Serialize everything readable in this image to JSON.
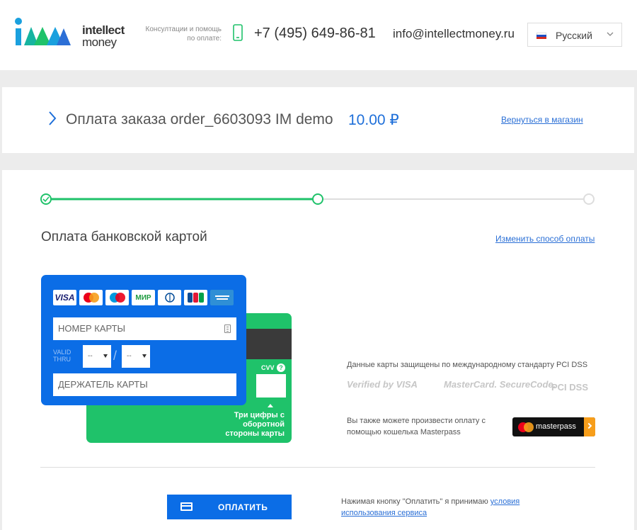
{
  "header": {
    "logo": {
      "line1": "intellect",
      "line2": "money"
    },
    "consult_text": "Консултации и помощь по оплате:",
    "phone": "+7 (495) 649-86-81",
    "email": "info@intellectmoney.ru",
    "language": "Русский"
  },
  "order": {
    "title": "Оплата заказа order_6603093 IM demo",
    "amount": "10.00 ₽",
    "back_link": "Вернуться в магазин"
  },
  "payment": {
    "progress": {
      "steps": 3,
      "completed_steps": 1,
      "current_step": 2
    },
    "section_title": "Оплата банковской картой",
    "change_link": "Изменить способ оплаты",
    "brands": [
      "VISA",
      "mastercard",
      "maestro",
      "МИР",
      "Diners Club",
      "JCB",
      "AMERICAN EXPRESS"
    ],
    "card_number_placeholder": "НОМЕР КАРТЫ",
    "valid_thru_line1": "VALID",
    "valid_thru_line2": "THRU",
    "month_value": "--",
    "year_value": "--",
    "slash": "/",
    "holder_placeholder": "ДЕРЖАТЕЛЬ КАРТЫ",
    "cvv_label": "CVV",
    "cvv_help": "?",
    "cvv_note": "Три цифры с оборотной стороны карты",
    "secure_text": "Данные карты защищены по международному стандарту PCI DSS",
    "secure_logos": {
      "verified": "Verified by VISA",
      "securecode": "MasterCard. SecureCode.",
      "pci": "PCI DSS"
    },
    "masterpass_text": "Вы также можете произвести оплату с помощью кошелька Masterpass",
    "masterpass_label": "masterpass",
    "pay_button": "ОПЛАТИТЬ",
    "terms_prefix": "Нажимая кнопку \"Оплатить\" я принимаю ",
    "terms_link": "условия использования сервиса"
  },
  "colors": {
    "accent": "#0b6de6",
    "success": "#1fc26a",
    "link": "#2a6fd6",
    "masterpass_arrow": "#f79e1b"
  }
}
